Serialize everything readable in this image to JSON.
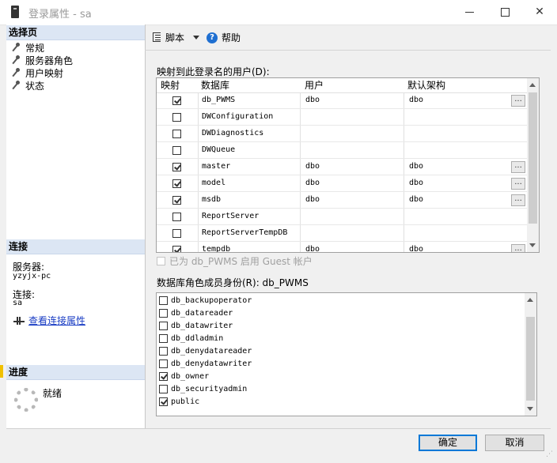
{
  "window": {
    "title": "登录属性 - sa"
  },
  "left_panel": {
    "select_page_header": "选择页",
    "nav_items": [
      {
        "label": "常规"
      },
      {
        "label": "服务器角色"
      },
      {
        "label": "用户映射"
      },
      {
        "label": "状态"
      }
    ],
    "connection_header": "连接",
    "server_label": "服务器:",
    "server_value": "yzyjx-pc",
    "connection_label": "连接:",
    "connection_value": "sa",
    "view_connection_link": "查看连接属性",
    "progress_header": "进度",
    "progress_status": "就绪"
  },
  "toolbar": {
    "script_label": "脚本",
    "help_label": "帮助"
  },
  "user_mapping": {
    "title": "映射到此登录名的用户(D):",
    "columns": [
      "映射",
      "数据库",
      "用户",
      "默认架构"
    ],
    "rows": [
      {
        "mapped": true,
        "database": "db_PWMS",
        "user": "dbo",
        "schema": "dbo",
        "has_browse": true
      },
      {
        "mapped": false,
        "database": "DWConfiguration",
        "user": "",
        "schema": "",
        "has_browse": false
      },
      {
        "mapped": false,
        "database": "DWDiagnostics",
        "user": "",
        "schema": "",
        "has_browse": false
      },
      {
        "mapped": false,
        "database": "DWQueue",
        "user": "",
        "schema": "",
        "has_browse": false
      },
      {
        "mapped": true,
        "database": "master",
        "user": "dbo",
        "schema": "dbo",
        "has_browse": true
      },
      {
        "mapped": true,
        "database": "model",
        "user": "dbo",
        "schema": "dbo",
        "has_browse": true
      },
      {
        "mapped": true,
        "database": "msdb",
        "user": "dbo",
        "schema": "dbo",
        "has_browse": true
      },
      {
        "mapped": false,
        "database": "ReportServer",
        "user": "",
        "schema": "",
        "has_browse": false
      },
      {
        "mapped": false,
        "database": "ReportServerTempDB",
        "user": "",
        "schema": "",
        "has_browse": false
      },
      {
        "mapped": true,
        "database": "tempdb",
        "user": "dbo",
        "schema": "dbo",
        "has_browse": true
      }
    ],
    "browse_label": "...",
    "guest_label": "已为 db_PWMS 启用 Guest 帐户"
  },
  "role_membership": {
    "title": "数据库角色成员身份(R): db_PWMS",
    "roles": [
      {
        "name": "db_backupoperator",
        "checked": false
      },
      {
        "name": "db_datareader",
        "checked": false
      },
      {
        "name": "db_datawriter",
        "checked": false
      },
      {
        "name": "db_ddladmin",
        "checked": false
      },
      {
        "name": "db_denydatareader",
        "checked": false
      },
      {
        "name": "db_denydatawriter",
        "checked": false
      },
      {
        "name": "db_owner",
        "checked": true
      },
      {
        "name": "db_securityadmin",
        "checked": false
      },
      {
        "name": "public",
        "checked": true
      }
    ]
  },
  "buttons": {
    "ok_label": "确定",
    "cancel_label": "取消"
  }
}
